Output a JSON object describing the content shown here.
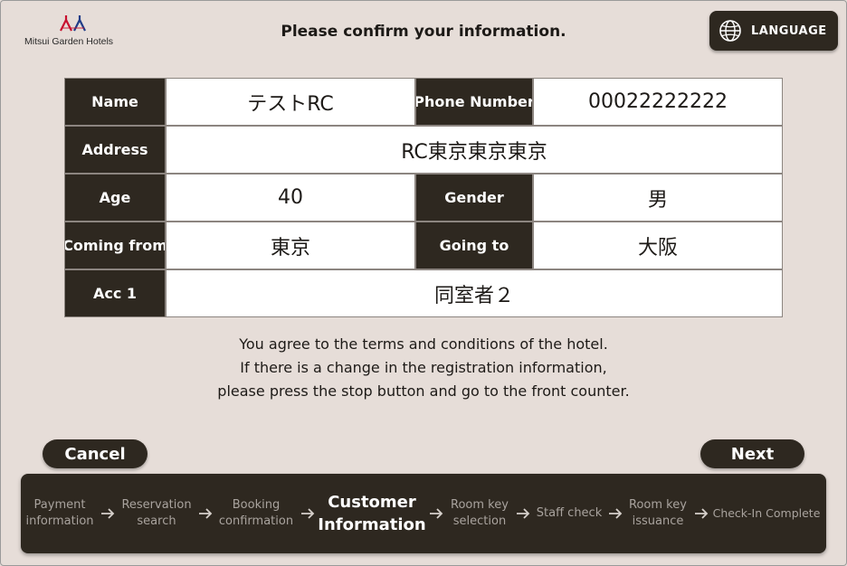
{
  "header": {
    "brand_name": "Mitsui Garden Hotels",
    "title": "Please confirm your information.",
    "language_label": "LANGUAGE"
  },
  "info": {
    "name_label": "Name",
    "name_value": "テストRC",
    "phone_label": "Phone Number",
    "phone_value": "00022222222",
    "address_label": "Address",
    "address_value": "RC東京東京東京",
    "age_label": "Age",
    "age_value": "40",
    "gender_label": "Gender",
    "gender_value": "男",
    "coming_from_label": "Coming from",
    "coming_from_value": "東京",
    "going_to_label": "Going to",
    "going_to_value": "大阪",
    "acc_label": "Acc 1",
    "acc_value": "同室者２"
  },
  "notice": {
    "line1": "You agree to the terms and conditions of the hotel.",
    "line2": "If there is a change in the registration information,",
    "line3": "please press the stop button and go to the front counter."
  },
  "actions": {
    "cancel_label": "Cancel",
    "next_label": "Next"
  },
  "steps": [
    {
      "label": "Payment\ninformation",
      "current": false
    },
    {
      "label": "Reservation\nsearch",
      "current": false
    },
    {
      "label": "Booking\nconfirmation",
      "current": false
    },
    {
      "label": "Customer\nInformation",
      "current": true
    },
    {
      "label": "Room key\nselection",
      "current": false
    },
    {
      "label": "Staff check",
      "current": false
    },
    {
      "label": "Room key\nissuance",
      "current": false
    },
    {
      "label": "Check-In Complete",
      "current": false
    }
  ],
  "colors": {
    "background": "#e6ddd8",
    "dark": "#2e2820",
    "logo_red": "#c8102e",
    "logo_blue": "#1f3c88"
  }
}
